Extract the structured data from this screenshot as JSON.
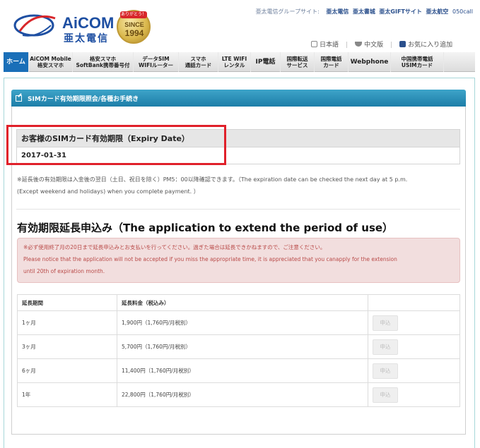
{
  "header": {
    "logo_main": "AiCOM",
    "logo_sub": "亜太電信",
    "since_banner": "ありがとう！",
    "since_label": "SINCE",
    "since_year": "1994",
    "group_label": "亜太電信グループサイト:",
    "group_links": [
      "亜太電信",
      "亜太書城",
      "亜太GIFTサイト",
      "亜太航空"
    ],
    "group_last": "050call",
    "lang": [
      "日本語",
      "中文版",
      "お気に入り追加"
    ]
  },
  "nav": {
    "items": [
      {
        "label": "ホーム"
      },
      {
        "label": "AiCOM Mobile\n格安スマホ"
      },
      {
        "label": "格安スマホ\nSoftBank携帯番号付"
      },
      {
        "label": "データSIM\nWIFIルーター"
      },
      {
        "label": "スマホ\n通話カード"
      },
      {
        "label": "LTE WIFI\nレンタル"
      },
      {
        "label": "IP電話"
      },
      {
        "label": "国際転送\nサービス"
      },
      {
        "label": "国際電話\nカード"
      },
      {
        "label": "Webphone"
      },
      {
        "label": "中国携帯電話\nUSIMカード"
      }
    ]
  },
  "panel": {
    "title": "SIMカード有効期限照会/各種お手続き"
  },
  "expiry": {
    "title": "お客様のSIMカード有効期限（Expiry Date）",
    "date": "2017-01-31"
  },
  "note": {
    "line1": "※延長後の有効期限は入金後の翌日（土日、祝日を除く）PM5：00以降確認できます。（The expiration date can be checked the next day at 5 p.m.",
    "line2": "(Except weekend and holidays) when you complete payment. ）"
  },
  "extension": {
    "title": "有効期限延長申込み（The application to extend the period of use）",
    "alert_line1": "※必ず使用終了月の20日まで延長申込みとお支払いを行ってください。過ぎた場合は延長できかねますので、ご注意ください。",
    "alert_line2": "Please notice that the application will not be accepted if you miss the appropriate time, it is appreciated that you canapply for the extension",
    "alert_line3": "until 20th of expiration month.",
    "table": {
      "headers": [
        "延長期間",
        "延長料金（税込み）",
        ""
      ],
      "rows": [
        {
          "period": "1ヶ月",
          "price": "1,900円（1,760円/月税別）",
          "button": "申込"
        },
        {
          "period": "3ヶ月",
          "price": "5,700円（1,760円/月税別）",
          "button": "申込"
        },
        {
          "period": "6ヶ月",
          "price": "11,400円（1,760円/月税別）",
          "button": "申込"
        },
        {
          "period": "1年",
          "price": "22,800円（1,760円/月税別）",
          "button": "申込"
        }
      ]
    }
  }
}
